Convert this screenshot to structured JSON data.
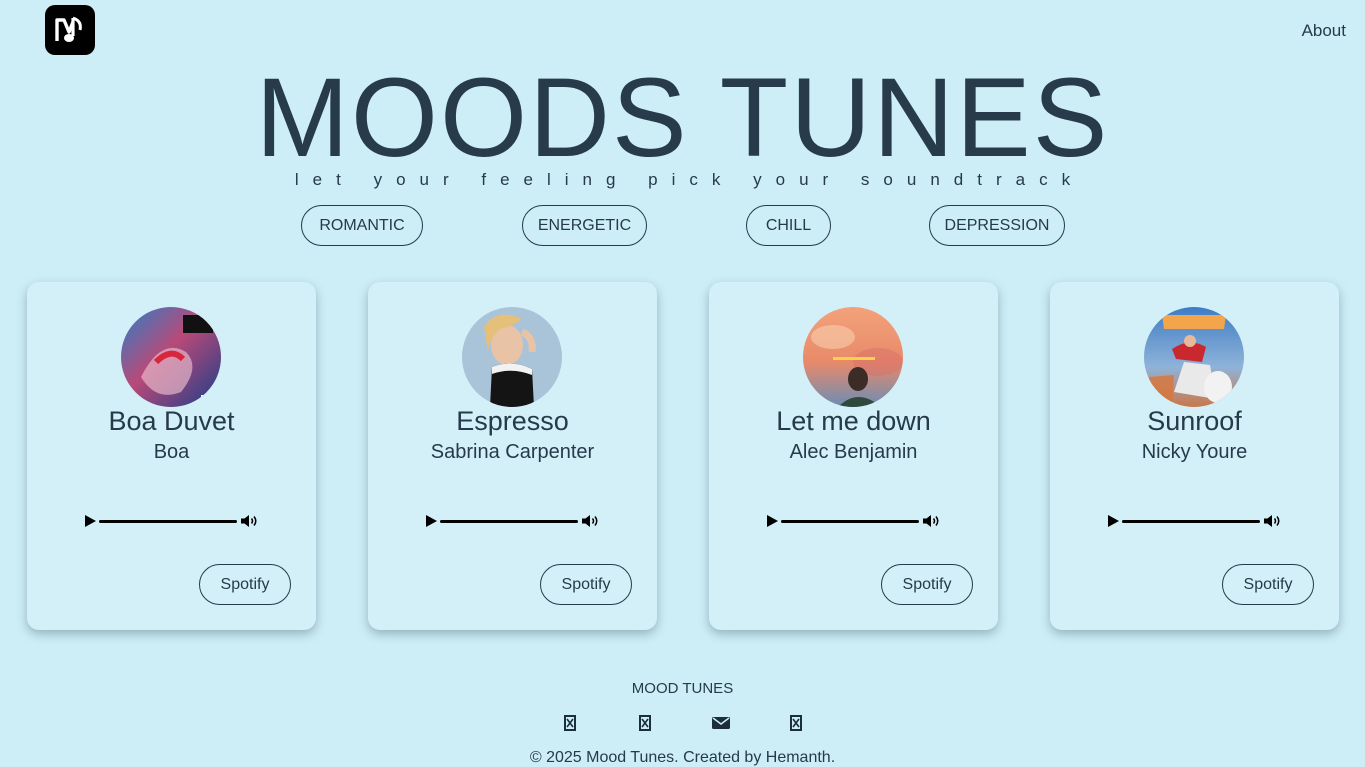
{
  "header": {
    "logo_icon": "music-note-logo-icon",
    "about_label": "About"
  },
  "hero": {
    "title": "MOODS TUNES",
    "tagline": "let your feeling pick your soundtrack"
  },
  "moods": [
    {
      "label": "ROMANTIC"
    },
    {
      "label": "ENERGETIC"
    },
    {
      "label": "CHILL"
    },
    {
      "label": "DEPRESSION"
    }
  ],
  "cards": [
    {
      "title": "Boa Duvet",
      "artist": "Boa",
      "spotify_label": "Spotify",
      "progress": 0
    },
    {
      "title": "Espresso",
      "artist": "Sabrina Carpenter",
      "spotify_label": "Spotify",
      "progress": 0
    },
    {
      "title": "Let me down",
      "artist": "Alec Benjamin",
      "spotify_label": "Spotify",
      "progress": 0
    },
    {
      "title": "Sunroof",
      "artist": "Nicky Youre",
      "spotify_label": "Spotify",
      "progress": 0
    }
  ],
  "footer": {
    "title": "MOOD TUNES",
    "social_icons": [
      "missing-glyph-icon",
      "missing-glyph-icon",
      "envelope-icon",
      "missing-glyph-icon"
    ],
    "copyright": "© 2025 Mood Tunes. Created by Hemanth."
  },
  "colors": {
    "background": "#cdeef6",
    "card": "#d3f0f8",
    "text": "#263a4a"
  }
}
